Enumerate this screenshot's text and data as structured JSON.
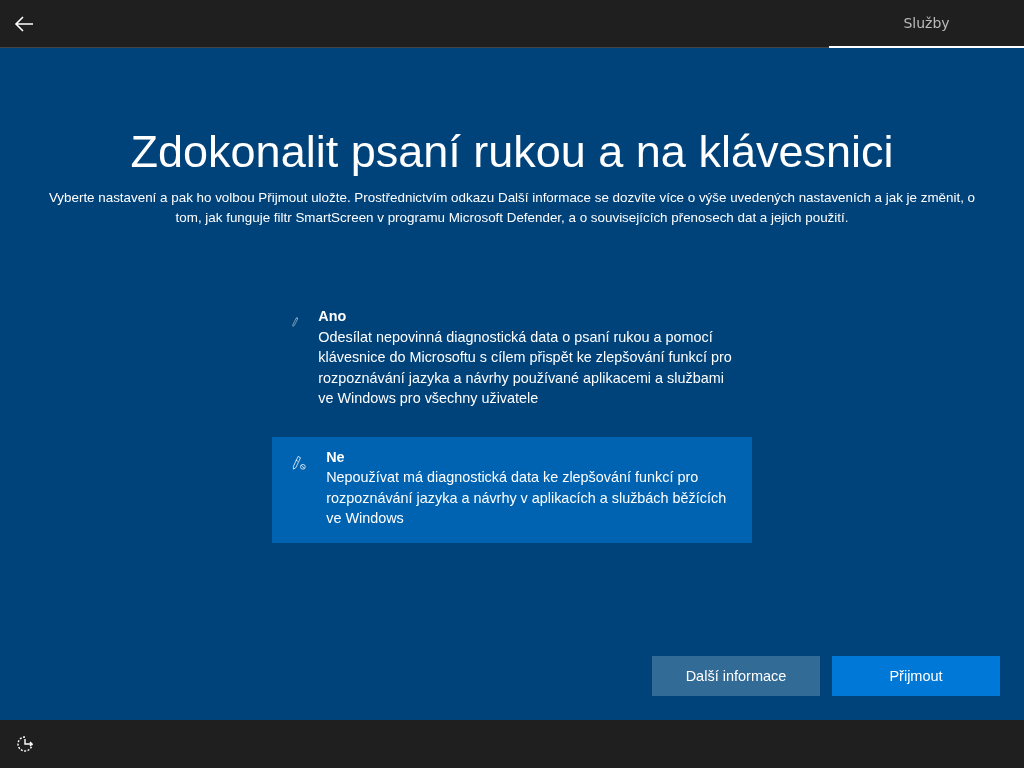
{
  "tabs": [
    {
      "label": "Služby",
      "selected": true
    }
  ],
  "title": "Zdokonalit psaní rukou a na klávesnici",
  "description": "Vyberte nastavení a pak ho volbou Přijmout uložte. Prostřednictvím odkazu Další informace se dozvíte více o výše uvedených nastaveních a jak je změnit, o tom, jak funguje filtr SmartScreen v programu Microsoft Defender, a o souvisejících přenosech dat a jejich použití.",
  "options": [
    {
      "kind": "pen",
      "label": "Ano",
      "text": "Odesílat nepovinná diagnostická data o psaní rukou a pomocí klávesnice do Microsoftu s cílem přispět ke zlepšování funkcí pro rozpoznávání jazyka a návrhy používané aplikacemi a službami ve Windows pro všechny uživatele",
      "selected": false
    },
    {
      "kind": "pen-blocked",
      "label": "Ne",
      "text": "Nepoužívat má diagnostická data ke zlepšování funkcí pro rozpoznávání jazyka a návrhy v aplikacích a službách běžících ve Windows",
      "selected": true
    }
  ],
  "buttons": [
    {
      "kind": "secondary",
      "label": "Další informace"
    },
    {
      "kind": "primary",
      "label": "Přijmout"
    }
  ]
}
